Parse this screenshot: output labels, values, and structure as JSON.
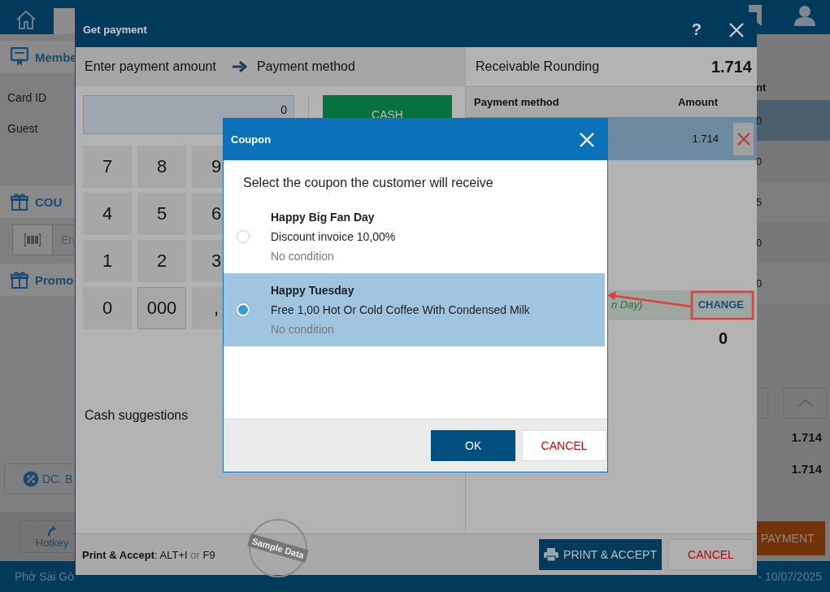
{
  "app": {
    "sidebar": {
      "member_header": "Membe",
      "card_id_label": "Card ID",
      "customer": "Guest",
      "coupon_header": "COU",
      "coupon_placeholder": "En",
      "promo_header": "Promo",
      "discount_button": "DC. B",
      "hotkeys_button": "Hotkey"
    },
    "order": {
      "column_header": "nt",
      "rows": [
        {
          "value": "0",
          "selected": true
        },
        {
          "value": "0",
          "selected": false
        },
        {
          "value": "5",
          "selected": false
        },
        {
          "value": "0",
          "selected": false
        },
        {
          "value": "0",
          "selected": false
        }
      ],
      "totals": [
        "1.714",
        "1.714"
      ],
      "payment_button": "PAYMENT"
    },
    "status_bar": {
      "store": "Phở Sài Gò",
      "date": "- 10/07/2025"
    }
  },
  "payment_dialog": {
    "title": "Get payment",
    "help": "?",
    "steps": [
      "Enter payment amount",
      "Payment method"
    ],
    "amount": "0",
    "method_button": "CASH",
    "keypad": [
      "7",
      "8",
      "9",
      "4",
      "5",
      "6",
      "1",
      "2",
      "3",
      "0",
      "000",
      ","
    ],
    "cash_suggestions_label": "Cash suggestions",
    "shortcut": {
      "text": "**Print & Accept**: ALT+I",
      "separator": "or",
      "key": "F9"
    },
    "sample_stamp": "Sample Data",
    "receivable": {
      "label": "Receivable Rounding",
      "value": "1.714"
    },
    "columns": [
      "Payment method",
      "Amount"
    ],
    "payments": [
      {
        "amount": "1.714",
        "selected": true
      }
    ],
    "coupon_line": {
      "text": "n Day)",
      "action": "CHANGE"
    },
    "remaining": "0",
    "buttons": {
      "print": "PRINT & ACCEPT",
      "cancel": "CANCEL"
    }
  },
  "coupon_dialog": {
    "title": "Coupon",
    "prompt": "Select the coupon the customer will receive",
    "coupons": [
      {
        "name": "Happy Big Fan Day",
        "description": "Discount invoice 10,00%",
        "condition": "No condition",
        "selected": false
      },
      {
        "name": "Happy Tuesday",
        "description": "Free 1,00 Hot Or Cold Coffee With Condensed Milk",
        "condition": "No condition",
        "selected": true
      }
    ],
    "ok": "OK",
    "cancel": "CANCEL"
  }
}
